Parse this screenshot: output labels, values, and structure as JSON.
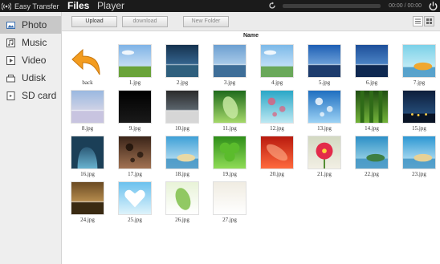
{
  "app": {
    "name": "Easy Transfer",
    "tabs": [
      {
        "label": "Files",
        "active": true
      },
      {
        "label": "Player",
        "active": false
      }
    ],
    "player": {
      "control_icon": "refresh-icon",
      "progress": 0.0,
      "time": "00:00 / 00:00"
    },
    "power_icon": "power-icon"
  },
  "sidebar": {
    "items": [
      {
        "label": "Photo",
        "icon": "photo-icon",
        "active": true
      },
      {
        "label": "Music",
        "icon": "music-icon",
        "active": false
      },
      {
        "label": "Video",
        "icon": "video-icon",
        "active": false
      },
      {
        "label": "Udisk",
        "icon": "udisk-icon",
        "active": false
      },
      {
        "label": "SD card",
        "icon": "sd-card-icon",
        "active": false
      }
    ]
  },
  "toolbar": {
    "upload_label": "Upload",
    "download_label": "download",
    "new_folder_label": "New Folder",
    "view_icons": [
      "list-view-icon",
      "grid-view-icon"
    ]
  },
  "file_list": {
    "sort_header": "Name",
    "back_label": "back",
    "files": [
      "1.jpg",
      "2.jpg",
      "3.jpg",
      "4.jpg",
      "5.jpg",
      "6.jpg",
      "7.jpg",
      "8.jpg",
      "9.jpg",
      "10.jpg",
      "11.jpg",
      "12.jpg",
      "13.jpg",
      "14.jpg",
      "15.jpg",
      "16.jpg",
      "17.jpg",
      "18.jpg",
      "19.jpg",
      "20.jpg",
      "21.jpg",
      "22.jpg",
      "23.jpg",
      "24.jpg",
      "25.jpg",
      "26.jpg",
      "27.jpg"
    ]
  },
  "colors": {
    "topbar": "#1b1b1b",
    "sidebar": "#eeeeee",
    "sidebar_active": "#c8c8c8",
    "back_arrow": "#f39c1f"
  }
}
